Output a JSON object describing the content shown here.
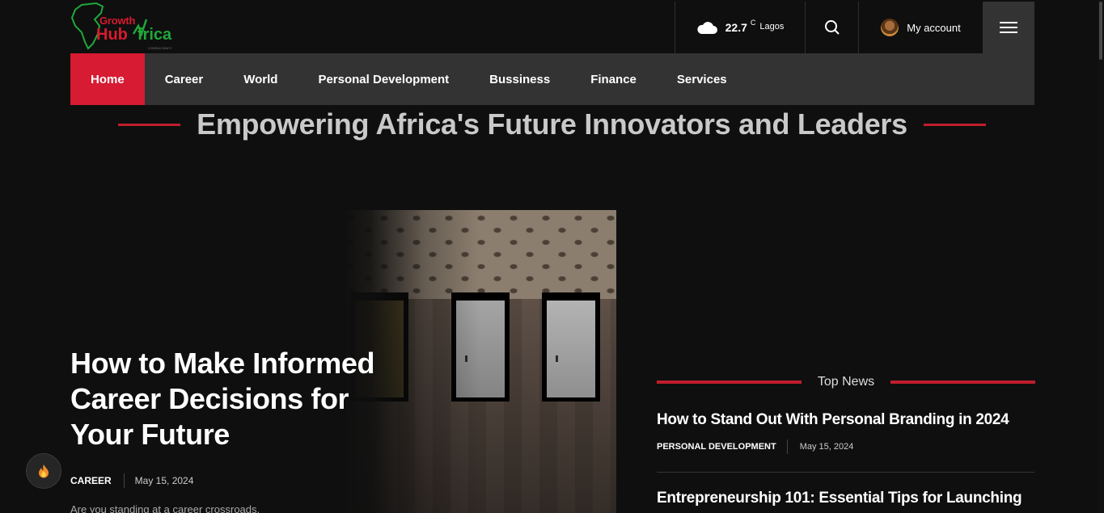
{
  "logo": {
    "top": "Growth",
    "hub": "Hub",
    "africa": "frica",
    "small": "CONSULTANCY"
  },
  "header": {
    "weather": {
      "temp": "22.7",
      "unit": "C",
      "city": "Lagos",
      "icon": "cloud-icon"
    },
    "account_label": "My account"
  },
  "nav": {
    "items": [
      {
        "label": "Home",
        "active": true
      },
      {
        "label": "Career"
      },
      {
        "label": "World"
      },
      {
        "label": "Personal Development"
      },
      {
        "label": "Bussiness"
      },
      {
        "label": "Finance"
      },
      {
        "label": "Services"
      }
    ]
  },
  "tagline": "Empowering Africa's Future Innovators and Leaders",
  "featured": {
    "title": "How to Make Informed Career Decisions for Your Future",
    "category": "CAREER",
    "date": "May 15, 2024",
    "excerpt": "Are you standing at a career crossroads,"
  },
  "top_news": {
    "heading": "Top News",
    "items": [
      {
        "title": "How to Stand Out With Personal Branding in 2024",
        "category": "PERSONAL DEVELOPMENT",
        "date": "May 15, 2024"
      },
      {
        "title": "Entrepreneurship 101: Essential Tips for Launching"
      }
    ]
  },
  "colors": {
    "accent": "#d71b33",
    "background": "#0f0f0f",
    "nav_bg": "#333333"
  }
}
